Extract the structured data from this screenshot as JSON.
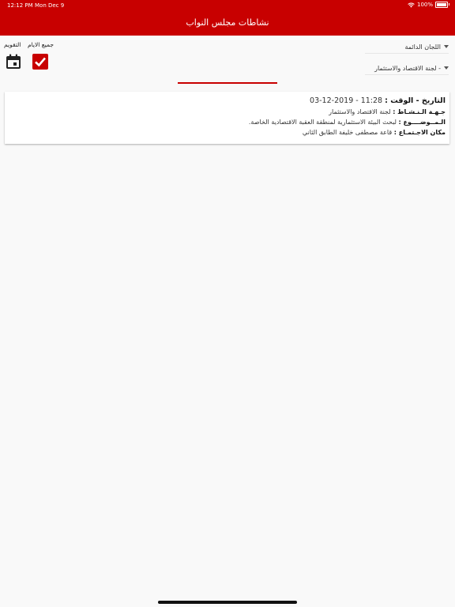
{
  "status_bar": {
    "time": "12:12 PM",
    "date": "Mon Dec 9",
    "battery": "100%"
  },
  "nav": {
    "title": "نشاطات مجلس النواب"
  },
  "filters": {
    "calendar_label": "التقويم",
    "all_days_label": "جميع الايام",
    "committee_type": "اللجان الدائمة",
    "committee": "- لجنة الاقتصاد والاستثمار"
  },
  "activities": [
    {
      "date_label": "التاريخ - الوقت :",
      "date_value": "03-12-2019 - 11:28",
      "org_label": "جـهـة الـنـشـاط :",
      "org_value": "لجنة الاقتصاد والاستثمار",
      "subject_label": "الـمــوضــــوع :",
      "subject_value": "لبحث البيئة الاستثمارية لمنطقة العقبة الاقتصادية الخاصة.",
      "place_label": "مكان الاجـتمـاع :",
      "place_value": "قاعة مصطفى خليفة الطابق الثاني"
    }
  ],
  "colors": {
    "accent": "#c80000"
  }
}
